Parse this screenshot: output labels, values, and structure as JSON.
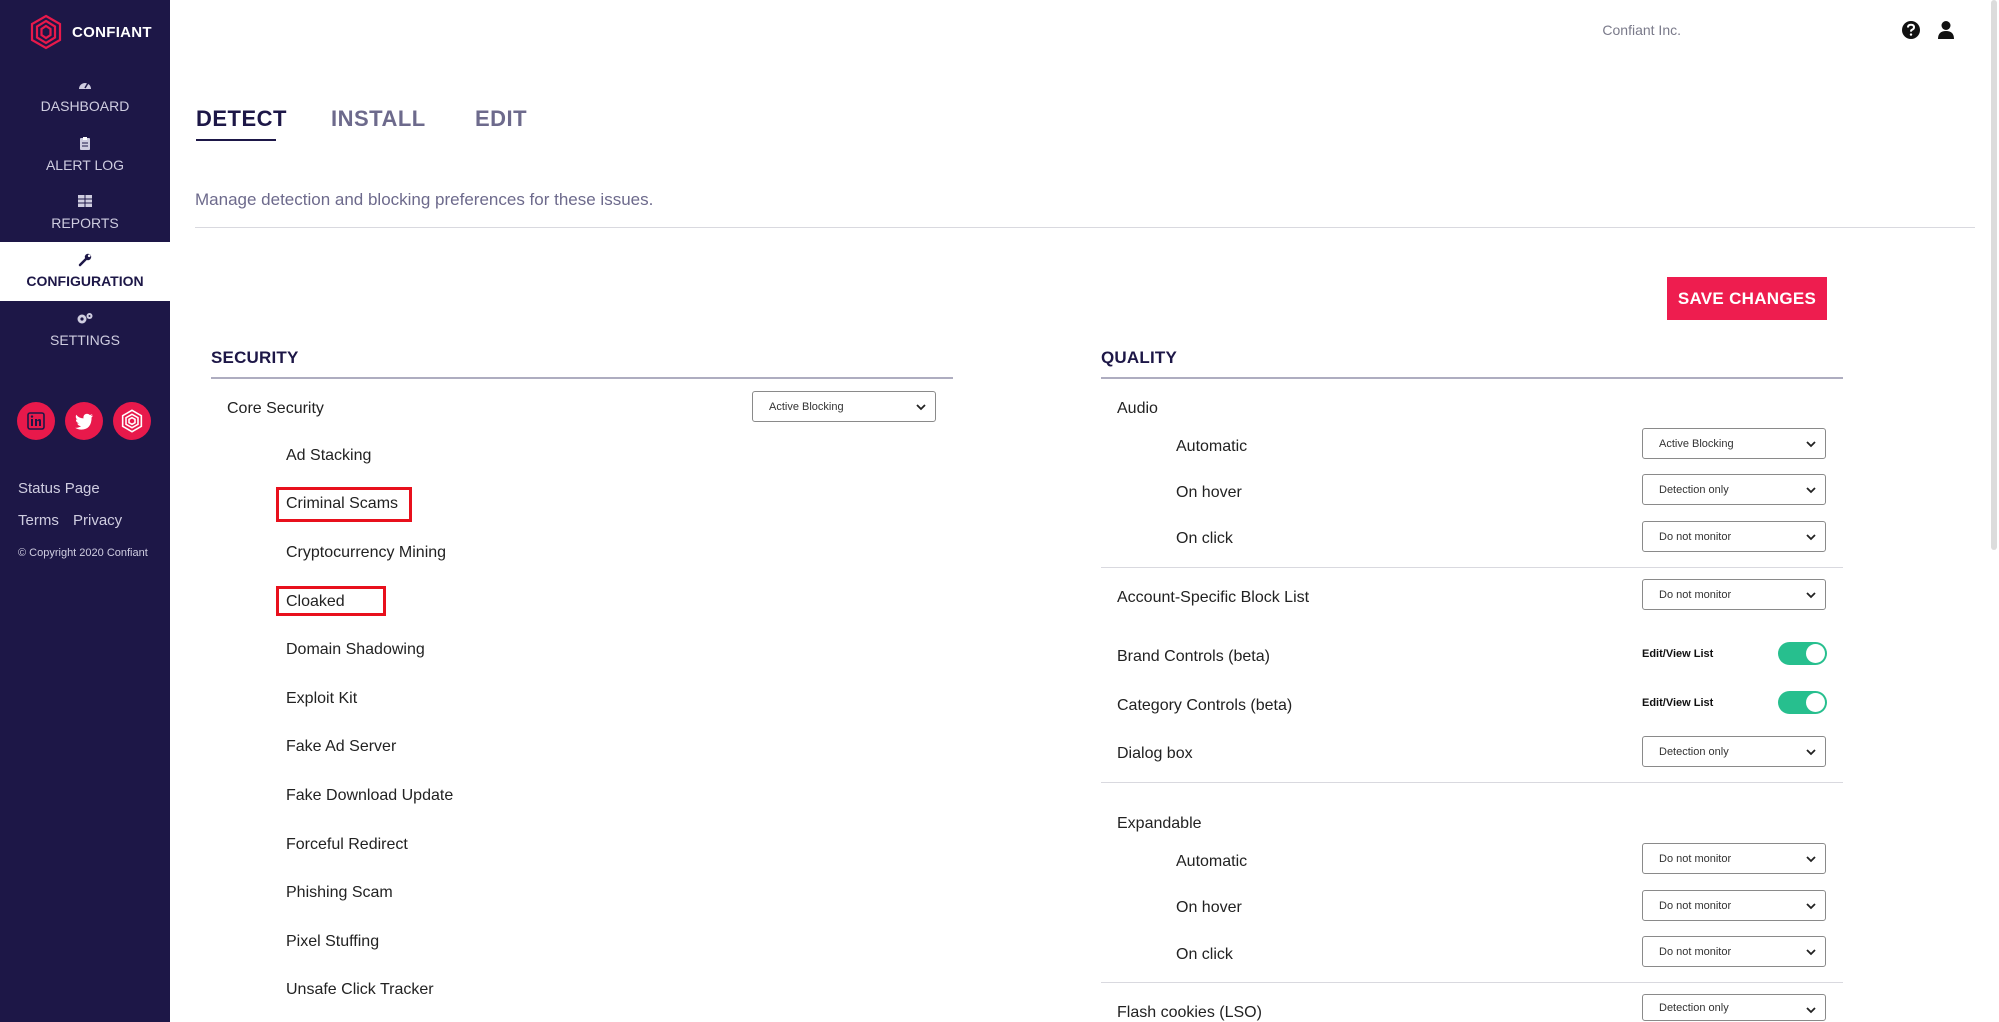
{
  "brand": {
    "name": "CONFIANT",
    "color": "#e8194b"
  },
  "sidebar": {
    "items": [
      {
        "label": "DASHBOARD",
        "icon": "gauge-icon"
      },
      {
        "label": "ALERT LOG",
        "icon": "clipboard-icon"
      },
      {
        "label": "REPORTS",
        "icon": "table-icon"
      },
      {
        "label": "CONFIGURATION",
        "icon": "wrench-icon",
        "active": true
      },
      {
        "label": "SETTINGS",
        "icon": "gears-icon"
      }
    ],
    "social": [
      "linkedin-icon",
      "twitter-icon",
      "confiant-icon"
    ],
    "status_page": "Status Page",
    "terms": "Terms",
    "privacy": "Privacy",
    "copyright": "© Copyright 2020 Confiant"
  },
  "topbar": {
    "company": "Confiant Inc."
  },
  "tabs": [
    "DETECT",
    "INSTALL",
    "EDIT"
  ],
  "description": "Manage detection and blocking preferences for these issues.",
  "save_label": "SAVE CHANGES",
  "security": {
    "title": "SECURITY",
    "core": {
      "label": "Core Security",
      "value": "Active Blocking"
    },
    "items": [
      "Ad Stacking",
      "Criminal Scams",
      "Cryptocurrency Mining",
      "Cloaked",
      "Domain Shadowing",
      "Exploit Kit",
      "Fake Ad Server",
      "Fake Download Update",
      "Forceful Redirect",
      "Phishing Scam",
      "Pixel Stuffing",
      "Unsafe Click Tracker"
    ]
  },
  "quality": {
    "title": "QUALITY",
    "audio": {
      "label": "Audio",
      "automatic": "Automatic",
      "automatic_value": "Active Blocking",
      "on_hover": "On hover",
      "on_hover_value": "Detection only",
      "on_click": "On click",
      "on_click_value": "Do not monitor"
    },
    "account_block": {
      "label": "Account-Specific Block List",
      "value": "Do not monitor"
    },
    "brand_controls": {
      "label": "Brand Controls (beta)",
      "link": "Edit/View List",
      "enabled": true
    },
    "category_controls": {
      "label": "Category Controls (beta)",
      "link": "Edit/View List",
      "enabled": true
    },
    "dialog_box": {
      "label": "Dialog box",
      "value": "Detection only"
    },
    "expandable": {
      "label": "Expandable",
      "automatic": "Automatic",
      "automatic_value": "Do not monitor",
      "on_hover": "On hover",
      "on_hover_value": "Do not monitor",
      "on_click": "On click",
      "on_click_value": "Do not monitor"
    },
    "flash": {
      "label": "Flash cookies (LSO)",
      "value": "Detection only"
    }
  },
  "colors": {
    "sidebar": "#1d1747",
    "accent": "#ee1d4f",
    "toggle": "#27bf8e",
    "highlight": "#e8101c"
  }
}
